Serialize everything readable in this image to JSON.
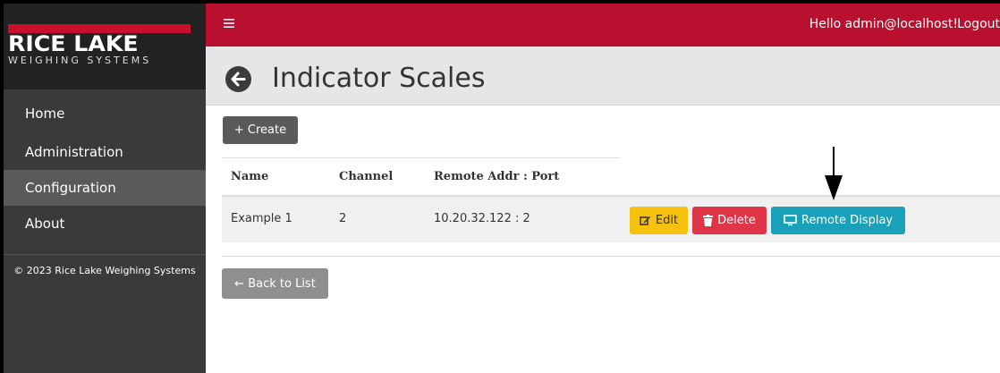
{
  "brand": {
    "name": "RICE LAKE",
    "subtitle": "WEIGHING SYSTEMS"
  },
  "sidebar": {
    "items": [
      {
        "label": "Home"
      },
      {
        "label": "Administration"
      },
      {
        "label": "Configuration",
        "active": true
      },
      {
        "label": "About"
      }
    ],
    "footer": "© 2023 Rice Lake Weighing Systems"
  },
  "topbar": {
    "menu_icon": "hamburger-icon",
    "greeting": "Hello admin@localhost!",
    "logout_label": "Logout"
  },
  "page": {
    "title": "Indicator Scales",
    "back_icon": "arrow-left-circle-icon"
  },
  "toolbar": {
    "create_label": "+ Create"
  },
  "table": {
    "columns": [
      "Name",
      "Channel",
      "Remote Addr : Port"
    ],
    "rows": [
      {
        "name": "Example 1",
        "channel": "2",
        "remote": "10.20.32.122 : 2",
        "actions": {
          "edit_label": "Edit",
          "delete_label": "Delete",
          "remote_display_label": "Remote Display"
        }
      }
    ]
  },
  "footer_actions": {
    "back_label": "← Back to List"
  },
  "colors": {
    "brand_red": "#b8102e",
    "sidebar_bg": "#3a3a3a",
    "edit": "#f6c10f",
    "delete": "#df3548",
    "remote": "#18a1b8"
  }
}
